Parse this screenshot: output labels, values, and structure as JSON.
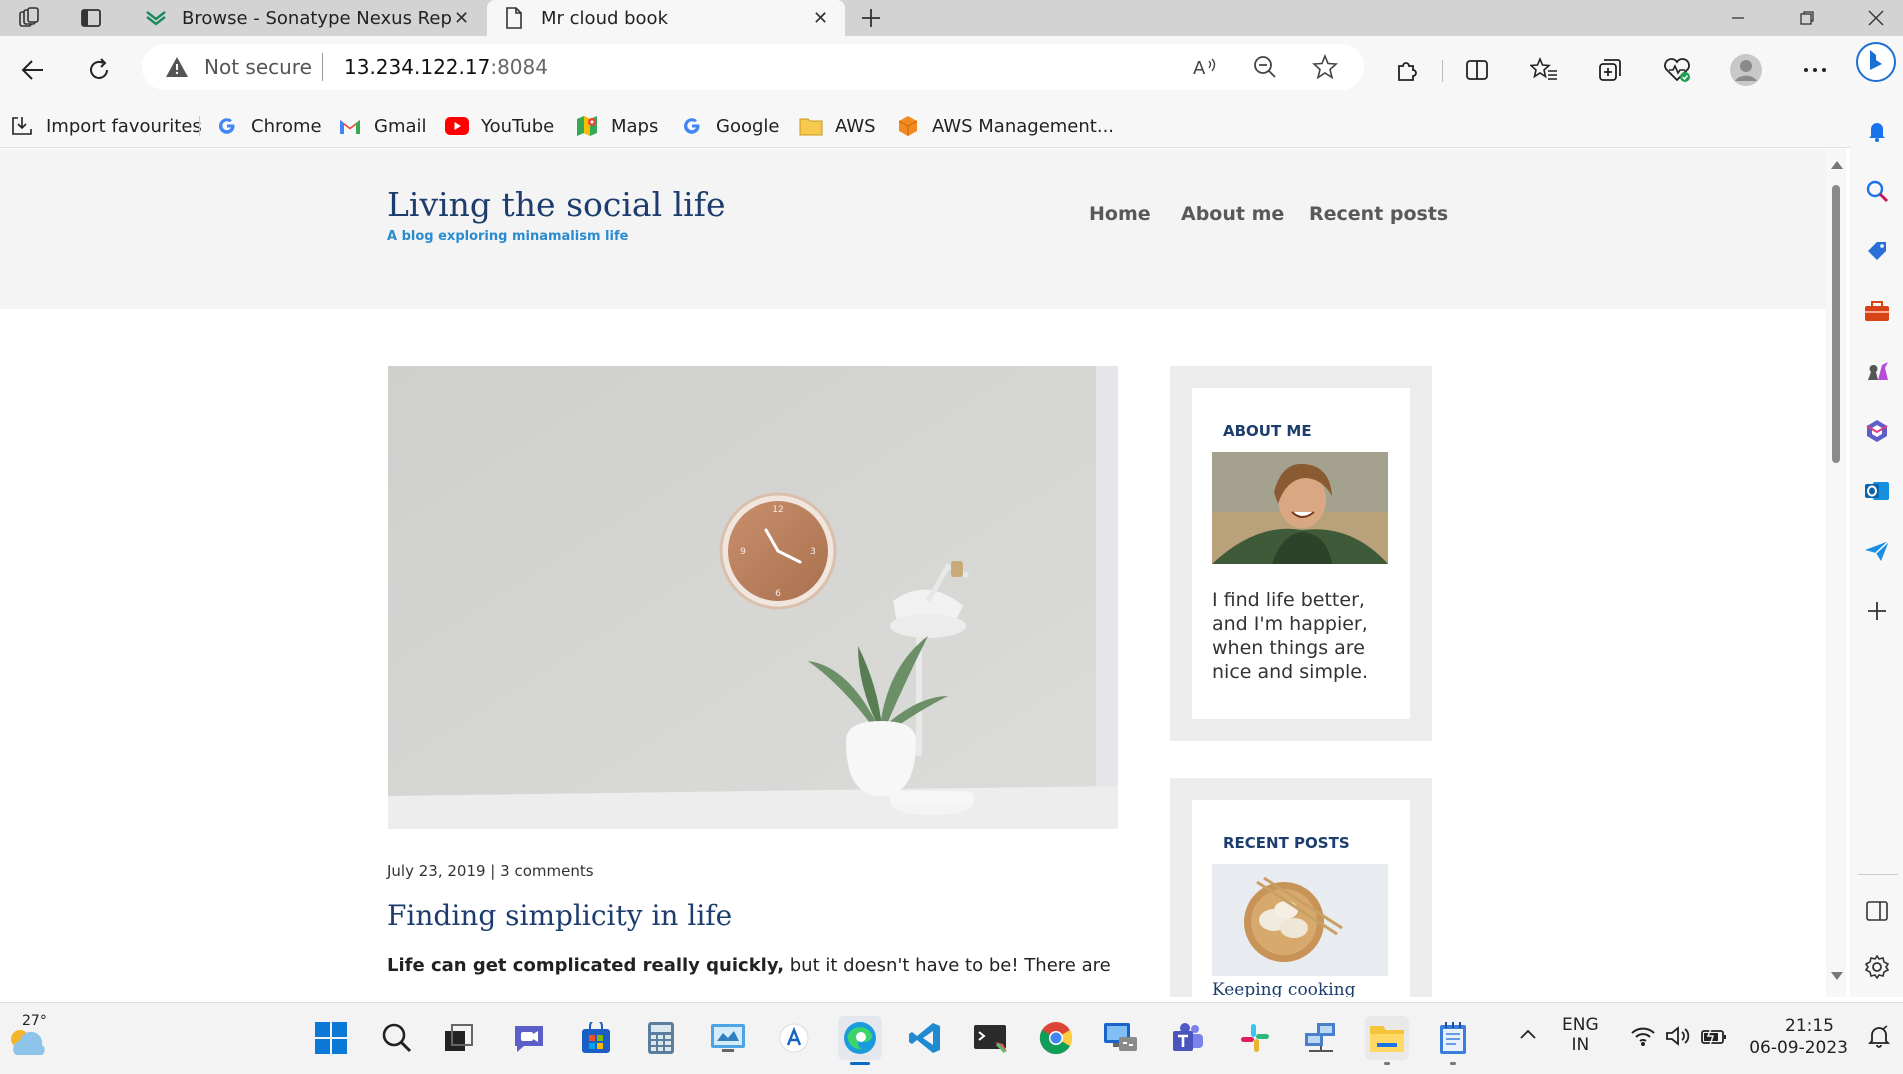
{
  "tabs": [
    {
      "title": "Browse - Sonatype Nexus Reposi",
      "active": false
    },
    {
      "title": "Mr cloud book",
      "active": true
    }
  ],
  "address": {
    "security": "Not secure",
    "host": "13.234.122.17",
    "port": ":8084"
  },
  "favourites": [
    {
      "label": "Import favourites",
      "icon": "import-icon"
    },
    {
      "label": "Chrome",
      "icon": "google-icon"
    },
    {
      "label": "Gmail",
      "icon": "gmail-icon"
    },
    {
      "label": "YouTube",
      "icon": "youtube-icon"
    },
    {
      "label": "Maps",
      "icon": "maps-icon"
    },
    {
      "label": "Google",
      "icon": "google-icon"
    },
    {
      "label": "AWS",
      "icon": "folder-icon"
    },
    {
      "label": "AWS Management...",
      "icon": "aws-icon"
    }
  ],
  "site": {
    "title": "Living the social life",
    "subtitle": "A blog exploring minamalism life",
    "nav": [
      "Home",
      "About me",
      "Recent posts"
    ]
  },
  "post": {
    "meta": "July 23, 2019 | 3 comments",
    "title": "Finding simplicity in life",
    "lead_bold": "Life can get complicated really quickly,",
    "lead_rest": " but it doesn't have to be! There are"
  },
  "sidebar": {
    "about_heading": "ABOUT ME",
    "about_text": "I find life better, and I'm happier, when things are nice and simple.",
    "recent_heading": "RECENT POSTS",
    "recent_link": "Keeping cooking"
  },
  "taskbar": {
    "weather": "27°",
    "lang1": "ENG",
    "lang2": "IN",
    "time": "21:15",
    "date": "06-09-2023"
  },
  "colors": {
    "site_title": "#1c3d6e",
    "subtitle": "#2a8bd0",
    "accent_blue": "#0c62c0"
  }
}
